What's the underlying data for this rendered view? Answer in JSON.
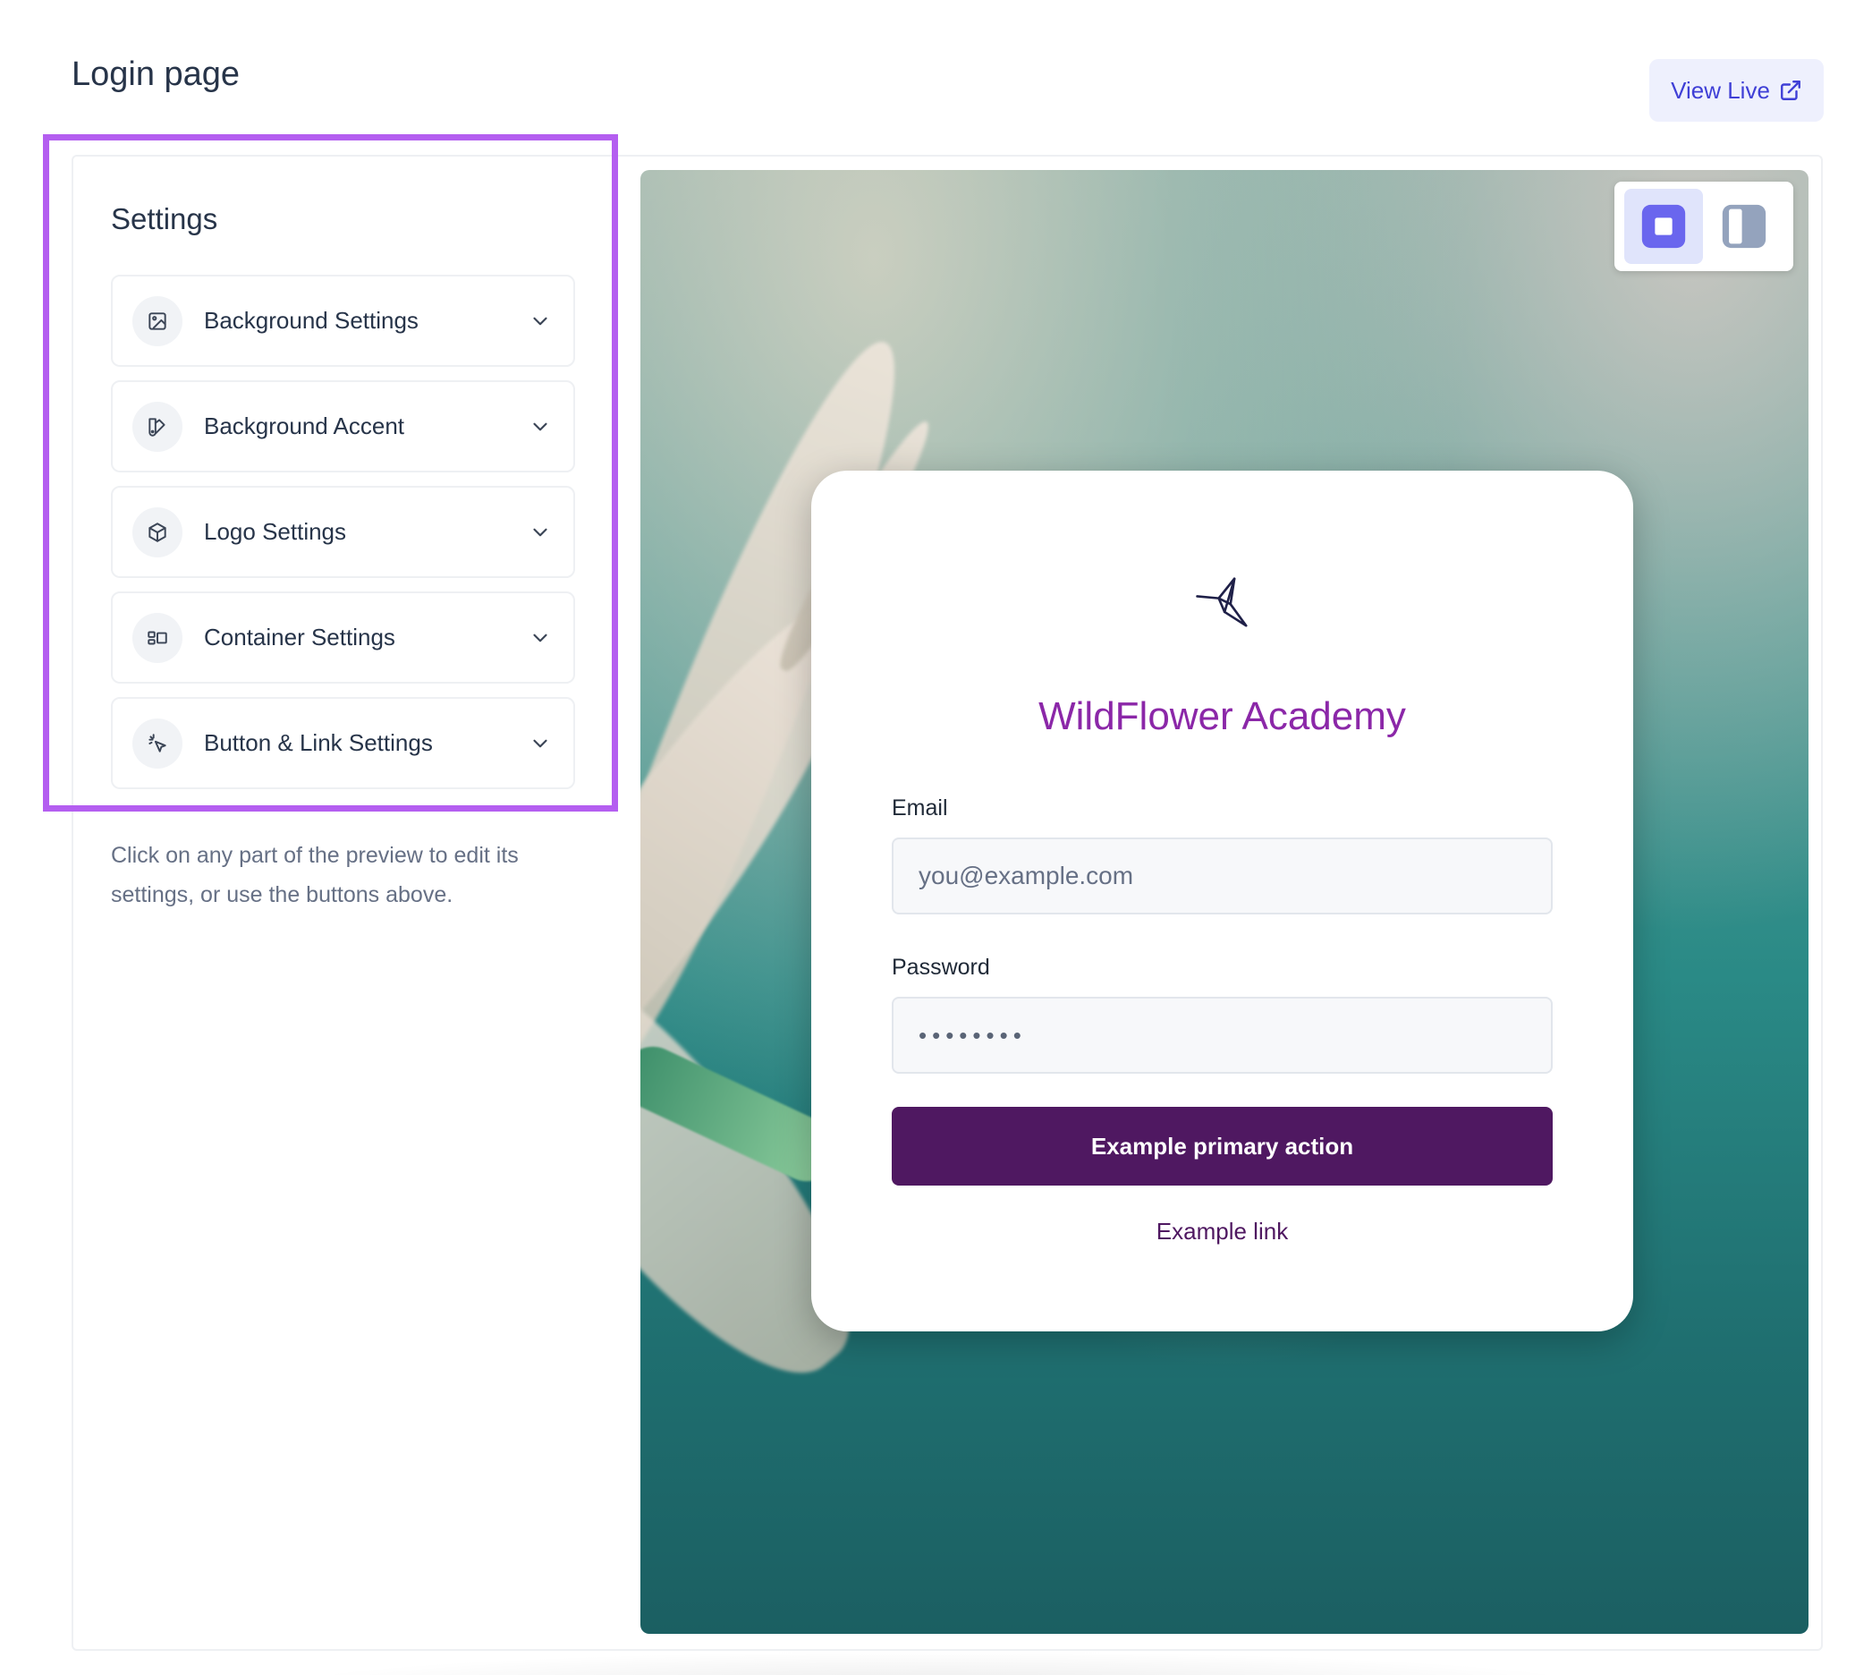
{
  "page": {
    "title": "Login page"
  },
  "header": {
    "view_live_label": "View Live"
  },
  "settings": {
    "title": "Settings",
    "items": [
      {
        "label": "Background Settings",
        "icon": "image-icon"
      },
      {
        "label": "Background Accent",
        "icon": "palette-icon"
      },
      {
        "label": "Logo Settings",
        "icon": "cube-icon"
      },
      {
        "label": "Container Settings",
        "icon": "layout-icon"
      },
      {
        "label": "Button & Link Settings",
        "icon": "cursor-click-icon"
      }
    ],
    "hint": "Click on any part of the preview to edit its settings, or use the buttons above."
  },
  "preview": {
    "layout_toggle": {
      "active": "centered"
    },
    "org_name": "WildFlower Academy",
    "email": {
      "label": "Email",
      "placeholder": "you@example.com"
    },
    "password": {
      "label": "Password",
      "value": "••••••••"
    },
    "primary_action": "Example primary action",
    "link": "Example link"
  },
  "colors": {
    "accent_highlight": "#b45ef0",
    "view_live_text": "#3f3fd6",
    "org_name": "#8b27a8",
    "primary_button": "#4f1861"
  }
}
